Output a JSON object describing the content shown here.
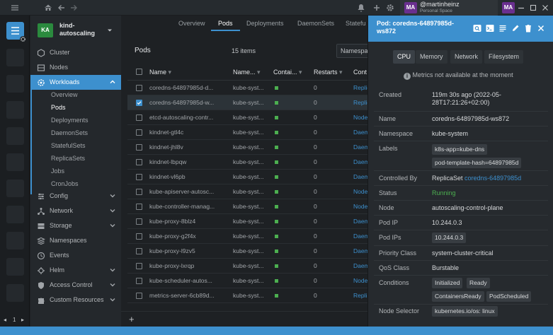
{
  "topbar": {
    "user_initials": "MA",
    "user_name": "@martinheinz",
    "user_space": "Personal Space",
    "avatar_color": "#6a2f8f"
  },
  "cluster": {
    "initials": "KA",
    "name": "kind-autoscaling"
  },
  "sidebar": {
    "items": [
      {
        "label": "Cluster"
      },
      {
        "label": "Nodes"
      },
      {
        "label": "Workloads"
      },
      {
        "label": "Config"
      },
      {
        "label": "Network"
      },
      {
        "label": "Storage"
      },
      {
        "label": "Namespaces"
      },
      {
        "label": "Events"
      },
      {
        "label": "Helm"
      },
      {
        "label": "Access Control"
      },
      {
        "label": "Custom Resources"
      }
    ],
    "workload_items": [
      "Overview",
      "Pods",
      "Deployments",
      "DaemonSets",
      "StatefulSets",
      "ReplicaSets",
      "Jobs",
      "CronJobs"
    ]
  },
  "tabs": [
    "Overview",
    "Pods",
    "Deployments",
    "DaemonSets",
    "Statefu"
  ],
  "list": {
    "title": "Pods",
    "count": "15 items",
    "namespace_filter": "Namespa",
    "columns": [
      "Name",
      "Name...",
      "Contai...",
      "Restarts",
      "Cont"
    ],
    "rows": [
      {
        "name": "coredns-64897985d-d...",
        "namespace": "kube-syst...",
        "restarts": "0",
        "controller": "Replic"
      },
      {
        "name": "coredns-64897985d-w...",
        "namespace": "kube-syst...",
        "restarts": "0",
        "controller": "Replic"
      },
      {
        "name": "etcd-autoscaling-contr...",
        "namespace": "kube-syst...",
        "restarts": "0",
        "controller": "Node"
      },
      {
        "name": "kindnet-gtl4c",
        "namespace": "kube-syst...",
        "restarts": "0",
        "controller": "Daem"
      },
      {
        "name": "kindnet-jhl8v",
        "namespace": "kube-syst...",
        "restarts": "0",
        "controller": "Daem"
      },
      {
        "name": "kindnet-lbpqw",
        "namespace": "kube-syst...",
        "restarts": "0",
        "controller": "Daem"
      },
      {
        "name": "kindnet-vl6pb",
        "namespace": "kube-syst...",
        "restarts": "0",
        "controller": "Daem"
      },
      {
        "name": "kube-apiserver-autosc...",
        "namespace": "kube-syst...",
        "restarts": "0",
        "controller": "Node"
      },
      {
        "name": "kube-controller-manag...",
        "namespace": "kube-syst...",
        "restarts": "0",
        "controller": "Node"
      },
      {
        "name": "kube-proxy-8blz4",
        "namespace": "kube-syst...",
        "restarts": "0",
        "controller": "Daem"
      },
      {
        "name": "kube-proxy-g2f4x",
        "namespace": "kube-syst...",
        "restarts": "0",
        "controller": "Daem"
      },
      {
        "name": "kube-proxy-l9zv5",
        "namespace": "kube-syst...",
        "restarts": "0",
        "controller": "Daem"
      },
      {
        "name": "kube-proxy-lxrqp",
        "namespace": "kube-syst...",
        "restarts": "0",
        "controller": "Daem"
      },
      {
        "name": "kube-scheduler-autos...",
        "namespace": "kube-syst...",
        "restarts": "0",
        "controller": "Node"
      },
      {
        "name": "metrics-server-6cb89d...",
        "namespace": "kube-syst...",
        "restarts": "0",
        "controller": "Repli"
      }
    ],
    "selected_index": 1,
    "running_color": "#4caf50"
  },
  "details": {
    "title": "Pod: coredns-64897985d-ws872",
    "metric_tabs": [
      "CPU",
      "Memory",
      "Network",
      "Filesystem"
    ],
    "metrics_note": "Metrics not available at the moment",
    "fields": {
      "created_label": "Created",
      "created_value": "119m 30s ago (2022-05-28T17:21:26+02:00)",
      "name_label": "Name",
      "name_value": "coredns-64897985d-ws872",
      "namespace_label": "Namespace",
      "namespace_value": "kube-system",
      "labels_label": "Labels",
      "labels": [
        "k8s-app=kube-dns",
        "pod-template-hash=64897985d"
      ],
      "controlled_label": "Controlled By",
      "controlled_kind": "ReplicaSet",
      "controlled_link": "coredns-64897985d",
      "status_label": "Status",
      "status_value": "Running",
      "node_label": "Node",
      "node_value": "autoscaling-control-plane",
      "podip_label": "Pod IP",
      "podip_value": "10.244.0.3",
      "podips_label": "Pod IPs",
      "podips_value": "10.244.0.3",
      "priority_label": "Priority Class",
      "priority_value": "system-cluster-critical",
      "qos_label": "QoS Class",
      "qos_value": "Burstable",
      "conditions_label": "Conditions",
      "conditions": [
        "Initialized",
        "Ready",
        "ContainersReady",
        "PodScheduled"
      ],
      "selector_label": "Node Selector",
      "selector_value": "kubernetes.io/os: linux"
    }
  },
  "bottom": {
    "page": "1"
  },
  "colors": {
    "accent": "#3d90ce",
    "running": "#4caf50",
    "link": "#3d90ce"
  }
}
